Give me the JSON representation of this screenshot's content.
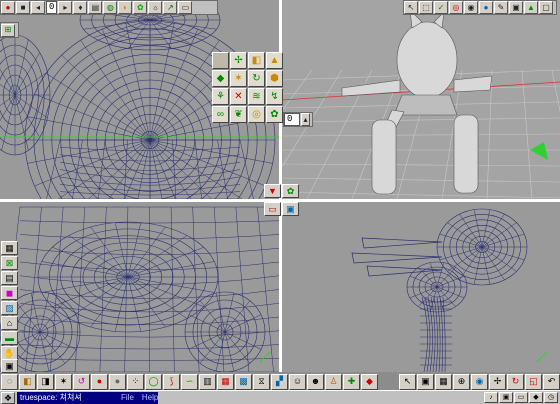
{
  "colors": {
    "wire": "#2b2e6e",
    "wire_light": "#4a4f9a",
    "viewport_bg": "#9a9a9a",
    "persp_bg": "#a4a4a4",
    "grid": "#c8c8c8",
    "axis_green": "#2fd02f",
    "axis_red": "#e03030",
    "model_shade": "#d8d8d8"
  },
  "top_toolbar": {
    "frame_value": "0",
    "icons": [
      "record-icon",
      "stop-icon",
      "frame-back-icon",
      "play-icon",
      "key-icon",
      "film-icon",
      "globe-icon",
      "render-icon",
      "object-icon",
      "lamp-icon",
      "paint-icon",
      "window-icon"
    ]
  },
  "persp_toolbar": {
    "icons": [
      "arrow-icon",
      "select-icon",
      "check-icon",
      "target-icon",
      "eye-icon",
      "sphere-icon",
      "pencil-icon",
      "camera-icon",
      "triangle-icon",
      "box-icon"
    ]
  },
  "persp_frame_field": {
    "value": "0"
  },
  "palette_icons": [
    "cube-icon",
    "move-icon",
    "scale-icon",
    "cone-icon",
    "sphere-icon",
    "lathe-icon",
    "extrude-icon",
    "bevel-icon",
    "bone-icon",
    "tree-icon",
    "wave-icon",
    "spiral-icon",
    "knot-icon",
    "leaf-icon",
    "torus-icon",
    "blob-icon"
  ],
  "side_icons": [
    "grid-icon",
    "mesh-icon",
    "material-icon",
    "color-icon",
    "image-icon",
    "view-icon",
    "paint-icon",
    "light-icon",
    "hand-icon",
    "camera-icon",
    "nav-icon"
  ],
  "bottom_icons": [
    "ball-icon",
    "box-icon",
    "paint-icon",
    "film-icon",
    "hook-icon",
    "color-icon",
    "sphere-icon",
    "brush-icon",
    "dots-icon",
    "leaf-icon",
    "snake-icon",
    "chart-icon",
    "grid-icon",
    "mesh-icon",
    "dna-icon",
    "paint-icon",
    "face-icon",
    "face2-icon",
    "person-icon",
    "hand-icon",
    "fill-icon"
  ],
  "bottom_right_icons": [
    "select-icon",
    "camera-icon",
    "grid-icon",
    "zoom-icon",
    "eye-icon",
    "move-icon",
    "rotate-icon",
    "scale-icon",
    "undo-icon"
  ],
  "taskbar": {
    "task_title": "truespace: 쳐쳐셔",
    "menu": [
      "File",
      "Help"
    ]
  }
}
